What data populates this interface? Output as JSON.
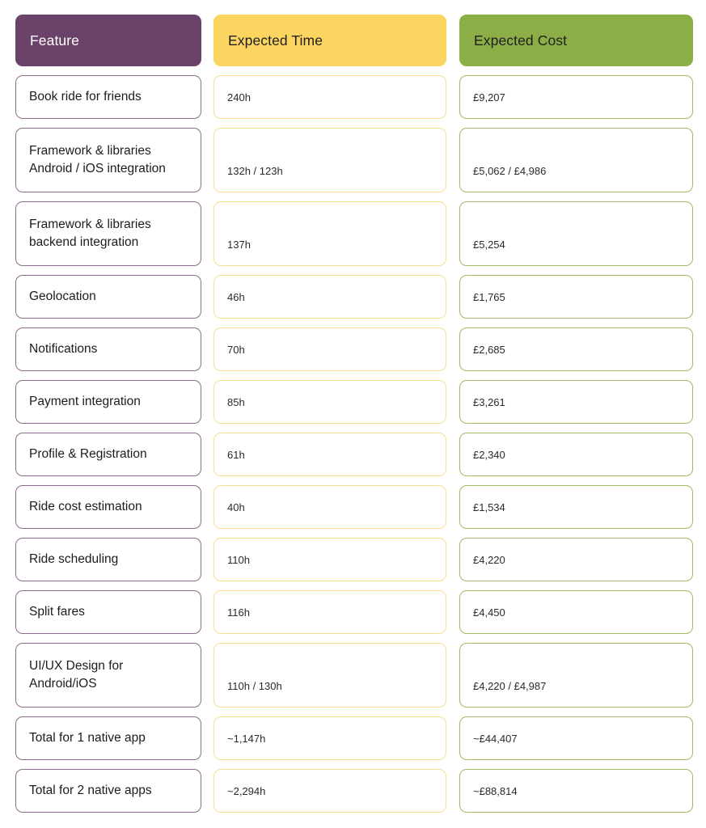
{
  "table": {
    "columns": [
      {
        "key": "feature",
        "label": "Feature",
        "header_bg": "#6B4269",
        "header_fg": "#ffffff",
        "cell_border": "#8E6A8C"
      },
      {
        "key": "time",
        "label": "Expected Time",
        "header_bg": "#FBD55F",
        "header_fg": "#1f1f1f",
        "cell_border": "#F9DE8E"
      },
      {
        "key": "cost",
        "label": "Expected Cost",
        "header_bg": "#8CAE46",
        "header_fg": "#1f1f1f",
        "cell_border": "#9DBB60"
      }
    ],
    "rows": [
      {
        "feature_line1": "Book ride for friends",
        "feature_line2": "",
        "time": "240h",
        "cost": "£9,207",
        "tall": false
      },
      {
        "feature_line1": "Framework & libraries",
        "feature_line2": "Android / iOS integration",
        "time": "132h / 123h",
        "cost": "£5,062 / £4,986",
        "tall": true
      },
      {
        "feature_line1": "Framework & libraries",
        "feature_line2": "backend integration",
        "time": "137h",
        "cost": "£5,254",
        "tall": true
      },
      {
        "feature_line1": "Geolocation",
        "feature_line2": "",
        "time": "46h",
        "cost": "£1,765",
        "tall": false
      },
      {
        "feature_line1": "Notifications",
        "feature_line2": "",
        "time": "70h",
        "cost": "£2,685",
        "tall": false
      },
      {
        "feature_line1": "Payment integration",
        "feature_line2": "",
        "time": "85h",
        "cost": "£3,261",
        "tall": false
      },
      {
        "feature_line1": "Profile & Registration",
        "feature_line2": "",
        "time": "61h",
        "cost": "£2,340",
        "tall": false
      },
      {
        "feature_line1": "Ride cost estimation",
        "feature_line2": "",
        "time": "40h",
        "cost": "£1,534",
        "tall": false
      },
      {
        "feature_line1": "Ride scheduling",
        "feature_line2": "",
        "time": "110h",
        "cost": "£4,220",
        "tall": false
      },
      {
        "feature_line1": "Split fares",
        "feature_line2": "",
        "time": "116h",
        "cost": "£4,450",
        "tall": false
      },
      {
        "feature_line1": "UI/UX Design for",
        "feature_line2": "Android/iOS",
        "time": "110h / 130h",
        "cost": "£4,220 / £4,987",
        "tall": true
      },
      {
        "feature_line1": "Total for 1 native app",
        "feature_line2": "",
        "time": "~1,147h",
        "cost": "~£44,407",
        "tall": false
      },
      {
        "feature_line1": "Total for 2 native apps",
        "feature_line2": "",
        "time": "~2,294h",
        "cost": "~£88,814",
        "tall": false
      }
    ]
  }
}
